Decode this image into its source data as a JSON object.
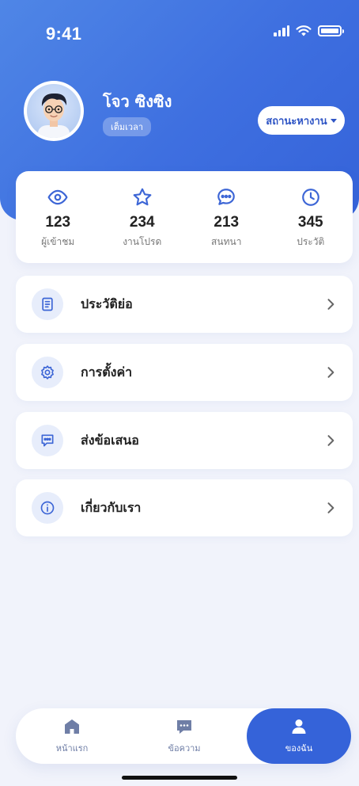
{
  "status_bar": {
    "time": "9:41"
  },
  "profile": {
    "name": "โจว ซิงซิง",
    "badge": "เต็มเวลา",
    "status_button": "สถานะหางาน"
  },
  "stats": [
    {
      "icon": "eye-icon",
      "value": "123",
      "label": "ผู้เข้าชม"
    },
    {
      "icon": "star-icon",
      "value": "234",
      "label": "งานโปรด"
    },
    {
      "icon": "chat-bubble-icon",
      "value": "213",
      "label": "สนทนา"
    },
    {
      "icon": "clock-icon",
      "value": "345",
      "label": "ประวัติ"
    }
  ],
  "menu": [
    {
      "icon": "document-icon",
      "label": "ประวัติย่อ"
    },
    {
      "icon": "gear-icon",
      "label": "การตั้งค่า"
    },
    {
      "icon": "feedback-icon",
      "label": "ส่งข้อเสนอ"
    },
    {
      "icon": "info-icon",
      "label": "เกี่ยวกับเรา"
    }
  ],
  "tabs": [
    {
      "icon": "home-icon",
      "label": "หน้าแรก",
      "active": false
    },
    {
      "icon": "message-icon",
      "label": "ข้อความ",
      "active": false
    },
    {
      "icon": "user-icon",
      "label": "ของฉัน",
      "active": true
    }
  ],
  "colors": {
    "primary": "#3563d9",
    "accent_light": "#e7edfb",
    "background": "#f1f3fb"
  }
}
